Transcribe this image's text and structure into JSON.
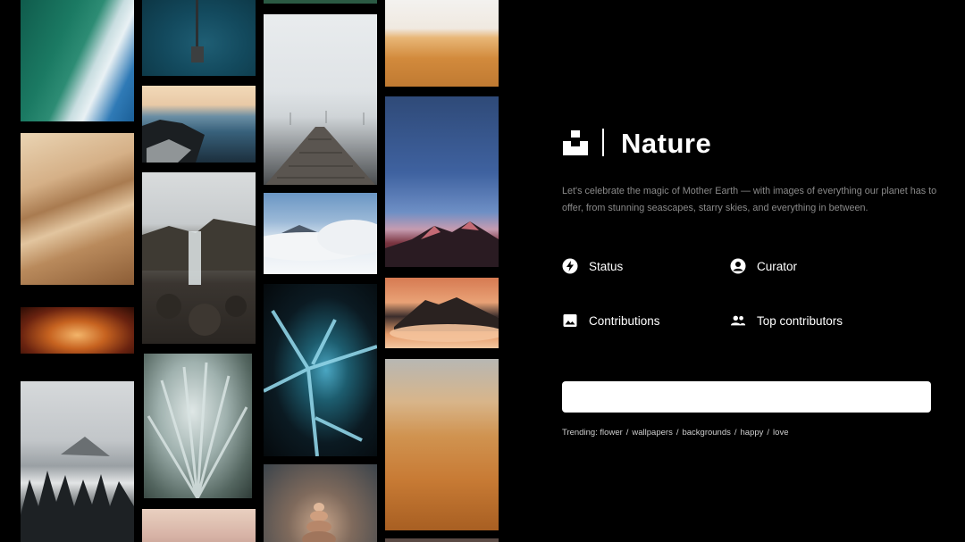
{
  "collection": {
    "title": "Nature",
    "description": "Let's celebrate the magic of Mother Earth — with images of everything our planet has to offer, from stunning seascapes, starry skies, and everything in between.",
    "logo_icon": "unsplash-logo-icon"
  },
  "stats": [
    {
      "label": "Status",
      "icon": "bolt-icon"
    },
    {
      "label": "Curator",
      "icon": "user-circle-icon"
    },
    {
      "label": "Contributions",
      "icon": "image-icon"
    },
    {
      "label": "Top contributors",
      "icon": "people-icon"
    }
  ],
  "search": {
    "value": "",
    "placeholder": ""
  },
  "trending": {
    "label": "Trending:",
    "items": [
      "flower",
      "wallpapers",
      "backgrounds",
      "happy",
      "love"
    ]
  },
  "gallery": {
    "photos": [
      "aerial-coast",
      "desert-dunes",
      "canyon-glow",
      "misty-forest",
      "pier-aerial",
      "rocky-shore",
      "waterfall",
      "frosty-plant",
      "pink-sky",
      "forest-edge",
      "boardwalk-fog",
      "snowy-peak",
      "frozen-ice",
      "stacked-stones",
      "sand-dune-sky",
      "mountain-dusk",
      "mountain-clouds",
      "sand-ripples",
      "bottom-strip"
    ]
  },
  "colors": {
    "background": "#000000",
    "text": "#ffffff",
    "muted_text": "#8a8a8a",
    "search_bg": "#ffffff"
  }
}
